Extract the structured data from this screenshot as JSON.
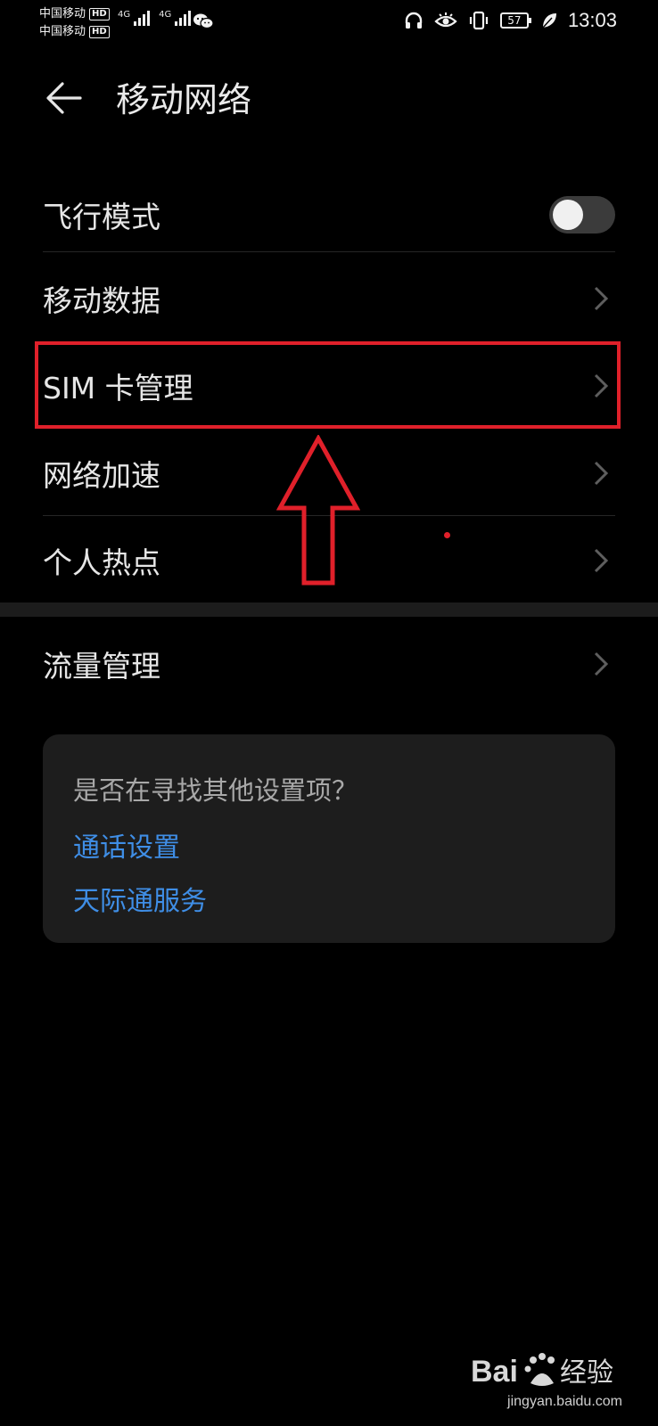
{
  "status_bar": {
    "carrier_1": "中国移动",
    "carrier_2": "中国移动",
    "hd_badge": "HD",
    "network_type": "4G",
    "battery": "57",
    "time": "13:03",
    "icons": [
      "headphones-icon",
      "eye-comfort-icon",
      "vibrate-icon",
      "battery-icon",
      "leaf-icon",
      "wechat-icon"
    ]
  },
  "header": {
    "title": "移动网络",
    "back_icon": "back-arrow-icon"
  },
  "settings": {
    "items": [
      {
        "label": "飞行模式",
        "control": "toggle",
        "toggle_on": false
      },
      {
        "label": "移动数据",
        "control": "chevron"
      },
      {
        "label": "SIM 卡管理",
        "control": "chevron"
      },
      {
        "label": "网络加速",
        "control": "chevron"
      },
      {
        "label": "个人热点",
        "control": "chevron"
      }
    ],
    "items_section_2": [
      {
        "label": "流量管理",
        "control": "chevron"
      }
    ]
  },
  "suggestion_card": {
    "title": "是否在寻找其他设置项？",
    "links": [
      "通话设置",
      "天际通服务"
    ]
  },
  "annotation": {
    "color": "#e0202a",
    "highlighted_item": "SIM 卡管理"
  },
  "watermark": {
    "brand": "Bai du 经验",
    "url": "jingyan.baidu.com"
  }
}
